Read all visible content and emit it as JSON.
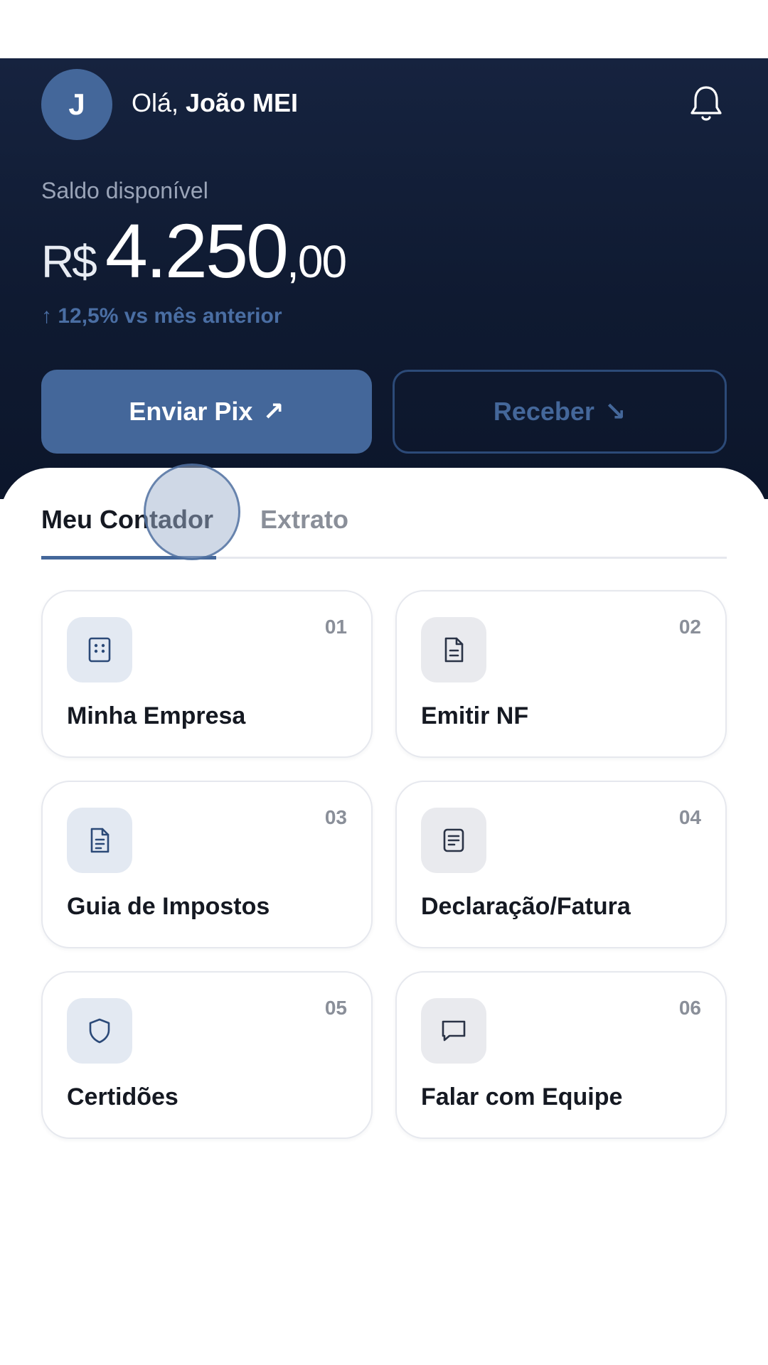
{
  "header": {
    "avatar_initial": "J",
    "greeting_prefix": "Olá, ",
    "user_name": "João MEI"
  },
  "balance": {
    "label": "Saldo disponível",
    "currency": "R$",
    "integer": "4.250",
    "decimals": ",00",
    "change": "↑ 12,5% vs mês anterior"
  },
  "actions": {
    "send_label": "Enviar Pix",
    "send_arrow": "↗",
    "receive_label": "Receber",
    "receive_arrow": "↘"
  },
  "tabs": [
    {
      "label": "Meu Contador",
      "active": true
    },
    {
      "label": "Extrato",
      "active": false
    }
  ],
  "cards": [
    {
      "num": "01",
      "title": "Minha Empresa",
      "icon": "building-icon"
    },
    {
      "num": "02",
      "title": "Emitir NF",
      "icon": "document-icon"
    },
    {
      "num": "03",
      "title": "Guia de Impostos",
      "icon": "tax-document-icon"
    },
    {
      "num": "04",
      "title": "Declaração/Fatura",
      "icon": "invoice-icon"
    },
    {
      "num": "05",
      "title": "Certidões",
      "icon": "shield-icon"
    },
    {
      "num": "06",
      "title": "Falar com Equipe",
      "icon": "chat-bubble-icon"
    }
  ],
  "colors": {
    "hero_bg": "#0f1a31",
    "accent": "#44679a",
    "text_dark": "#151922",
    "text_muted": "#8a8f99"
  }
}
